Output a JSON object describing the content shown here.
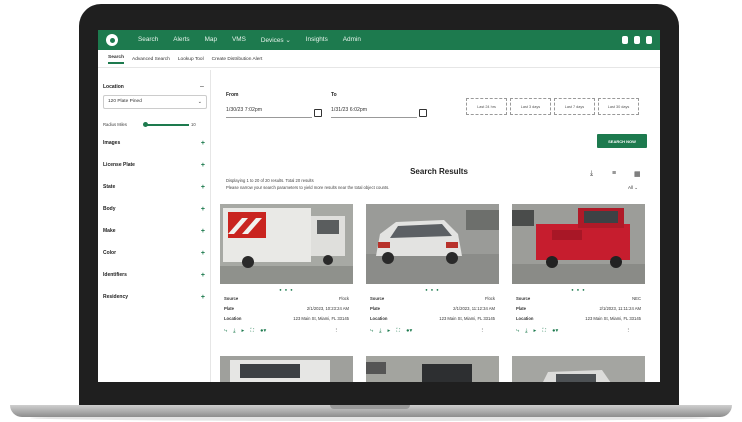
{
  "nav": {
    "items": [
      "Search",
      "Alerts",
      "Map",
      "VMS",
      "Devices ⌄",
      "Insights",
      "Admin"
    ]
  },
  "tabs": {
    "items": [
      "Search",
      "Advanced Search",
      "Lookup Tool",
      "Create Distribution Alert"
    ]
  },
  "sidebar": {
    "location_label": "Location",
    "location_value": "120 Plate Pined",
    "radius_label": "Radius Miles",
    "radius_value": "10",
    "facets": [
      "Images",
      "License Plate",
      "State",
      "Body",
      "Make",
      "Color",
      "Identifiers",
      "Residency"
    ]
  },
  "filters": {
    "from_label": "From",
    "from_value": "1/30/23 7:02pm",
    "to_label": "To",
    "to_value": "1/31/23 6:02pm",
    "quick_ranges": [
      "Last 24 hrs",
      "Last 3 days",
      "Last 7 days",
      "Last 30 days"
    ],
    "search_button": "SEARCH NOW"
  },
  "results": {
    "title": "Search Results",
    "summary_line1": "Displaying 1 to 20 of 20 results. Total 20 results",
    "summary_line2": "Please narrow your search parameters to yield more results near the total object counts.",
    "sort_label": "All ⌄"
  },
  "cards": [
    {
      "source_label": "Source",
      "source": "Flock",
      "plate_label": "Plate",
      "plate": "2/1/2023, 10:23:24 AM",
      "location_label": "Location",
      "location": "123 Main St, Miami, FL 33145"
    },
    {
      "source_label": "Source",
      "source": "Flock",
      "plate_label": "Plate",
      "plate": "2/1/2023, 11:12:34 AM",
      "location_label": "Location",
      "location": "123 Main St, Miami, FL 33145"
    },
    {
      "source_label": "Source",
      "source": "NEC",
      "plate_label": "Plate",
      "plate": "2/1/2023, 11:11:24 AM",
      "location_label": "Location",
      "location": "123 Main St, Miami, FL 33145"
    }
  ],
  "colors": {
    "brand": "#1d7a4e",
    "laptop_bezel": "#1f1f1f"
  }
}
